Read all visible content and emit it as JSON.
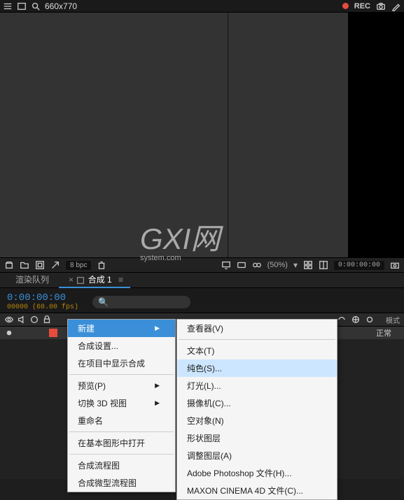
{
  "topbar": {
    "search_text": "660x770",
    "rec_label": "REC"
  },
  "watermark": {
    "main": "GXI网",
    "sub": "system.com"
  },
  "footer": {
    "bpc": "8 bpc",
    "zoom": "(50%)",
    "timecode": "0:00:00:00"
  },
  "tabs": {
    "render": "渲染队列",
    "comp": "合成 1",
    "comp_x": "×",
    "menu": "≡"
  },
  "timeline": {
    "timecode": "0:00:00:00",
    "frames": "00000 (60.00 fps)",
    "search_placeholder": ""
  },
  "layer_header": {
    "mode": "模式"
  },
  "layer_row": {
    "mode": "正常"
  },
  "context_menu": {
    "items": [
      {
        "label": "新建",
        "hl": true,
        "arrow": true
      },
      {
        "label": "合成设置..."
      },
      {
        "label": "在项目中显示合成"
      },
      {
        "sep": true
      },
      {
        "label": "预览(P)",
        "arrow": true
      },
      {
        "label": "切换 3D 视图",
        "arrow": true
      },
      {
        "label": "重命名"
      },
      {
        "sep": true
      },
      {
        "label": "在基本图形中打开"
      },
      {
        "sep": true
      },
      {
        "label": "合成流程图"
      },
      {
        "label": "合成微型流程图"
      }
    ],
    "submenu": [
      {
        "label": "查看器(V)"
      },
      {
        "sep": true
      },
      {
        "label": "文本(T)"
      },
      {
        "label": "纯色(S)...",
        "hl_row": true
      },
      {
        "label": "灯光(L)..."
      },
      {
        "label": "摄像机(C)..."
      },
      {
        "label": "空对象(N)"
      },
      {
        "label": "形状图层"
      },
      {
        "label": "调整图层(A)"
      },
      {
        "label": "Adobe Photoshop 文件(H)..."
      },
      {
        "label": "MAXON CINEMA 4D 文件(C)..."
      }
    ]
  }
}
